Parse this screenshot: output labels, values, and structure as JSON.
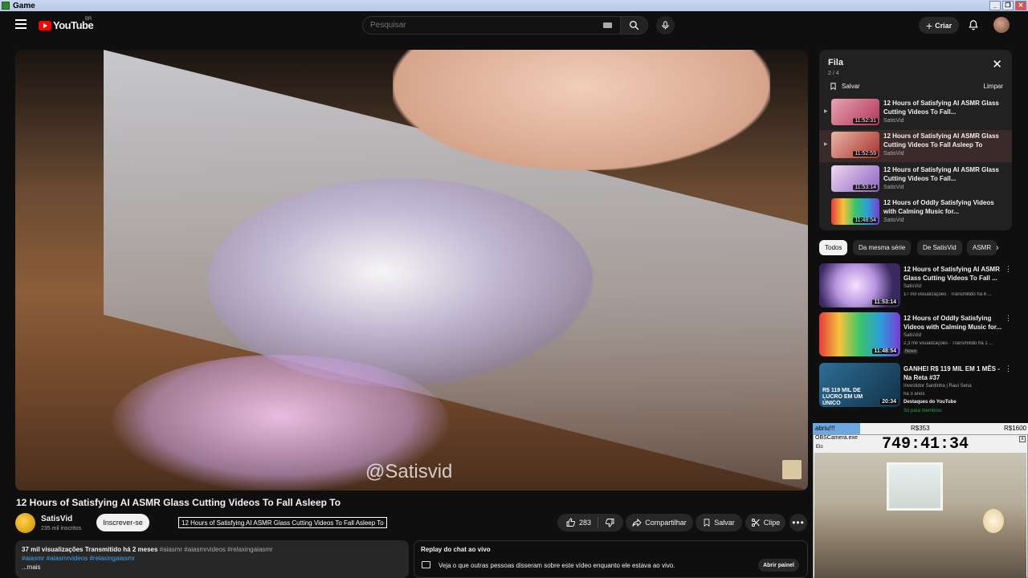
{
  "window": {
    "title": "Game",
    "controls": [
      "_",
      "❐",
      "✕"
    ]
  },
  "header": {
    "logo_text": "YouTube",
    "logo_country": "BR",
    "search_placeholder": "Pesquisar",
    "create_label": "Criar"
  },
  "video": {
    "watermark": "@Satisvid",
    "title": "12 Hours of Satisfying AI ASMR Glass Cutting Videos To Fall Asleep To",
    "tooltip": "12 Hours of Satisfying AI ASMR Glass Cutting Videos To Fall Asleep To"
  },
  "channel": {
    "name": "SatisVid",
    "subscribers": "235 mil inscritos",
    "subscribe_label": "Inscrever-se"
  },
  "actions": {
    "likes": "283",
    "share": "Compartilhar",
    "save": "Salvar",
    "clip": "Clipe",
    "more": "•••"
  },
  "description": {
    "views": "37 mil visualizações  Transmitido há 2 meses",
    "tags_inline": "#aiasmr #aiasmrvideos #relaxingaiasmr",
    "tags": "#aiasmr #aiasmrvideos #relaxingaiasmr",
    "more": "...mais"
  },
  "chat": {
    "title": "Replay do chat ao vivo",
    "text": "Veja o que outras pessoas disseram sobre este vídeo enquanto ele estava ao vivo.",
    "open_label": "Abrir painel"
  },
  "queue": {
    "title": "Fila",
    "count": "2 / 4",
    "save_label": "Salvar",
    "clear_label": "Limpar",
    "items": [
      {
        "title": "12 Hours of Satisfying AI ASMR Glass Cutting Videos To Fall...",
        "channel": "SatisVid",
        "duration": "11:52:31",
        "color": "#c95a6c"
      },
      {
        "title": "12 Hours of Satisfying AI ASMR Glass Cutting Videos To Fall Asleep To",
        "channel": "SatisVid",
        "duration": "11:52:59",
        "color": "#b8433a"
      },
      {
        "title": "12 Hours of Satisfying AI ASMR Glass Cutting Videos To Fall...",
        "channel": "SatisVid",
        "duration": "11:53:14",
        "color": "#8e6ec2"
      },
      {
        "title": "12 Hours of Oddly Satisfying Videos with Calming Music for...",
        "channel": "SatisVid",
        "duration": "11:48:54",
        "color": "#2b9ed8"
      }
    ]
  },
  "chips": [
    "Todos",
    "Da mesma série",
    "De SatisVid",
    "ASMR"
  ],
  "recommendations": [
    {
      "title": "12 Hours of Satisfying AI ASMR Glass Cutting Videos To Fall ...",
      "channel": "SatisVid",
      "meta": "17 mil visualizações · Transmitido há 6 ...",
      "duration": "11:53:14",
      "color": "#9a7fd4"
    },
    {
      "title": "12 Hours of Oddly Satisfying Videos with Calming Music for...",
      "channel": "SatisVid",
      "meta": "2,3 mil visualizações · Transmitido há 1 ...",
      "badge": "Novo",
      "duration": "11:48:54",
      "color": "#28a3d2"
    },
    {
      "title": "GANHEI R$ 119 MIL EM 1 MÊS - Na Reta #37",
      "channel": "Investidor Sardinha | Raul Sena",
      "meta": "há 3 anos",
      "footer": "Destaques do YouTube",
      "member": "Só para membros",
      "duration": "20:34",
      "thumb_text": "R$ 119 MIL DE LUCRO EM UM ÚNICO",
      "color": "#3b7fa8"
    }
  ],
  "overlay": {
    "goal_label": "abriu!!!",
    "amount": "R$353",
    "goal": "R$1600",
    "progress": 0.22,
    "camera_title": "OBSCamera.exe",
    "camera_sub": "Elo",
    "timer": "749:41:34"
  }
}
